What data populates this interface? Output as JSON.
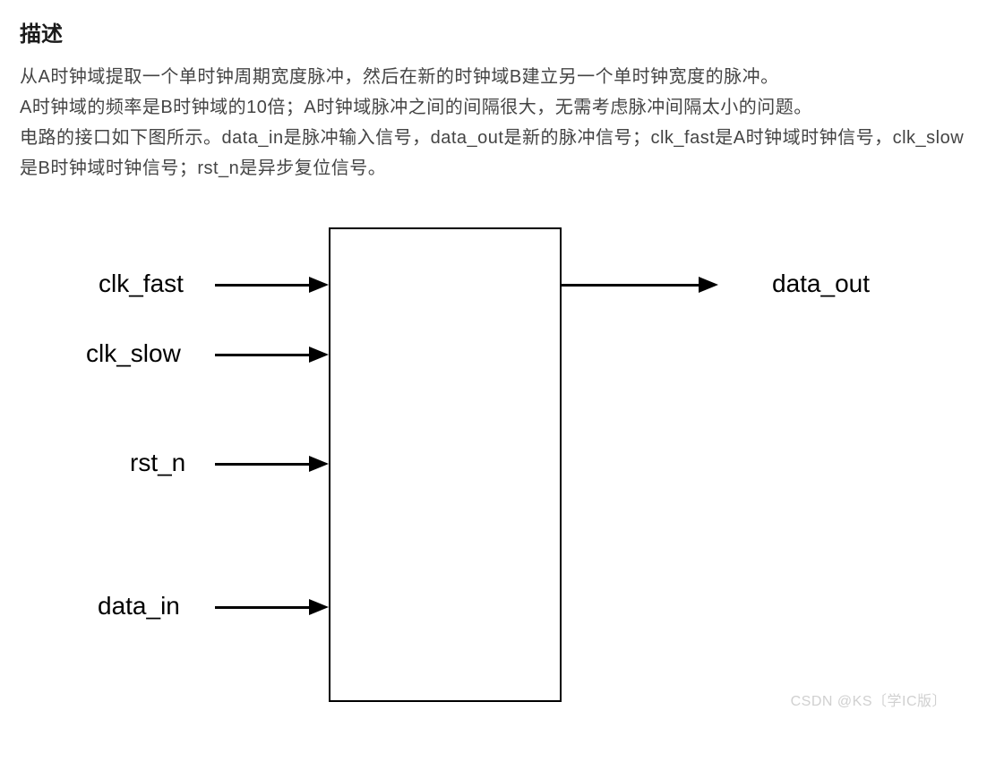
{
  "heading": "描述",
  "description_lines": [
    "从A时钟域提取一个单时钟周期宽度脉冲，然后在新的时钟域B建立另一个单时钟宽度的脉冲。",
    "A时钟域的频率是B时钟域的10倍；A时钟域脉冲之间的间隔很大，无需考虑脉冲间隔太小的问题。",
    "电路的接口如下图所示。data_in是脉冲输入信号，data_out是新的脉冲信号；clk_fast是A时钟域时钟信号，clk_slow是B时钟域时钟信号；rst_n是异步复位信号。"
  ],
  "diagram": {
    "inputs": [
      {
        "label": "clk_fast"
      },
      {
        "label": "clk_slow"
      },
      {
        "label": "rst_n"
      },
      {
        "label": "data_in"
      }
    ],
    "outputs": [
      {
        "label": "data_out"
      }
    ]
  },
  "watermark": "CSDN @KS〔学IC版〕"
}
